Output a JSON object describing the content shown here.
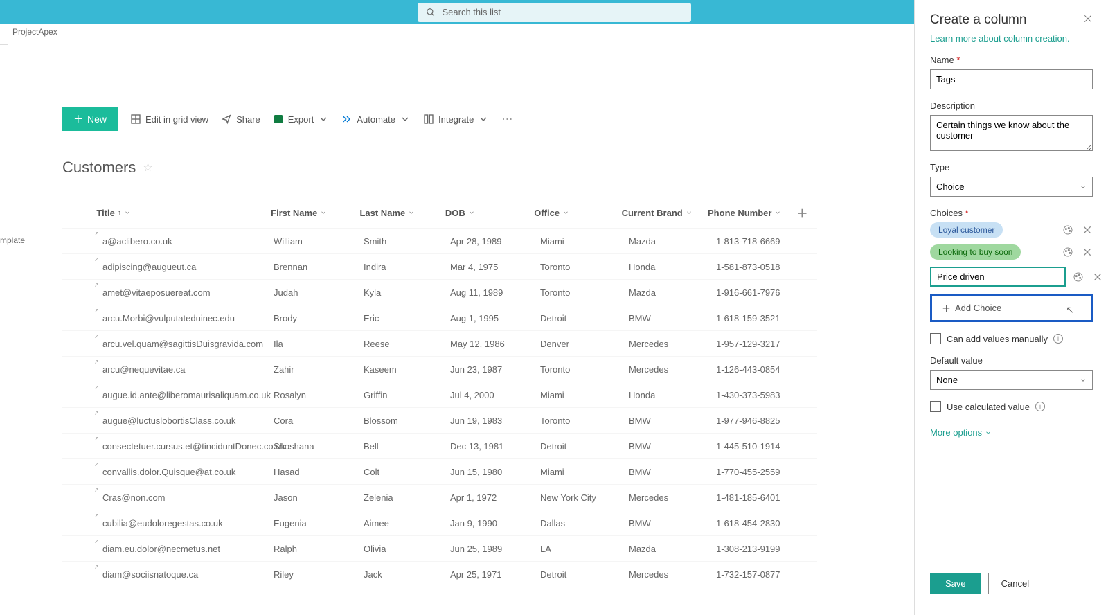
{
  "search": {
    "placeholder": "Search this list"
  },
  "breadcrumb": "ProjectApex",
  "leftnav": {
    "template": "mplate"
  },
  "cmdbar": {
    "new": "New",
    "edit_grid": "Edit in grid view",
    "share": "Share",
    "export": "Export",
    "automate": "Automate",
    "integrate": "Integrate"
  },
  "list": {
    "title": "Customers"
  },
  "columns": {
    "title": "Title",
    "first_name": "First Name",
    "last_name": "Last Name",
    "dob": "DOB",
    "office": "Office",
    "brand": "Current Brand",
    "phone": "Phone Number"
  },
  "rows": [
    {
      "title": "a@aclibero.co.uk",
      "fn": "William",
      "ln": "Smith",
      "dob": "Apr 28, 1989",
      "office": "Miami",
      "brand": "Mazda",
      "phone": "1-813-718-6669"
    },
    {
      "title": "adipiscing@augueut.ca",
      "fn": "Brennan",
      "ln": "Indira",
      "dob": "Mar 4, 1975",
      "office": "Toronto",
      "brand": "Honda",
      "phone": "1-581-873-0518"
    },
    {
      "title": "amet@vitaeposuereat.com",
      "fn": "Judah",
      "ln": "Kyla",
      "dob": "Aug 11, 1989",
      "office": "Toronto",
      "brand": "Mazda",
      "phone": "1-916-661-7976"
    },
    {
      "title": "arcu.Morbi@vulputateduinec.edu",
      "fn": "Brody",
      "ln": "Eric",
      "dob": "Aug 1, 1995",
      "office": "Detroit",
      "brand": "BMW",
      "phone": "1-618-159-3521"
    },
    {
      "title": "arcu.vel.quam@sagittisDuisgravida.com",
      "fn": "Ila",
      "ln": "Reese",
      "dob": "May 12, 1986",
      "office": "Denver",
      "brand": "Mercedes",
      "phone": "1-957-129-3217"
    },
    {
      "title": "arcu@nequevitae.ca",
      "fn": "Zahir",
      "ln": "Kaseem",
      "dob": "Jun 23, 1987",
      "office": "Toronto",
      "brand": "Mercedes",
      "phone": "1-126-443-0854"
    },
    {
      "title": "augue.id.ante@liberomaurisaliquam.co.uk",
      "fn": "Rosalyn",
      "ln": "Griffin",
      "dob": "Jul 4, 2000",
      "office": "Miami",
      "brand": "Honda",
      "phone": "1-430-373-5983"
    },
    {
      "title": "augue@luctuslobortisClass.co.uk",
      "fn": "Cora",
      "ln": "Blossom",
      "dob": "Jun 19, 1983",
      "office": "Toronto",
      "brand": "BMW",
      "phone": "1-977-946-8825"
    },
    {
      "title": "consectetuer.cursus.et@tinciduntDonec.co.uk",
      "fn": "Shoshana",
      "ln": "Bell",
      "dob": "Dec 13, 1981",
      "office": "Detroit",
      "brand": "BMW",
      "phone": "1-445-510-1914"
    },
    {
      "title": "convallis.dolor.Quisque@at.co.uk",
      "fn": "Hasad",
      "ln": "Colt",
      "dob": "Jun 15, 1980",
      "office": "Miami",
      "brand": "BMW",
      "phone": "1-770-455-2559"
    },
    {
      "title": "Cras@non.com",
      "fn": "Jason",
      "ln": "Zelenia",
      "dob": "Apr 1, 1972",
      "office": "New York City",
      "brand": "Mercedes",
      "phone": "1-481-185-6401"
    },
    {
      "title": "cubilia@eudoloregestas.co.uk",
      "fn": "Eugenia",
      "ln": "Aimee",
      "dob": "Jan 9, 1990",
      "office": "Dallas",
      "brand": "BMW",
      "phone": "1-618-454-2830"
    },
    {
      "title": "diam.eu.dolor@necmetus.net",
      "fn": "Ralph",
      "ln": "Olivia",
      "dob": "Jun 25, 1989",
      "office": "LA",
      "brand": "Mazda",
      "phone": "1-308-213-9199"
    },
    {
      "title": "diam@sociisnatoque.ca",
      "fn": "Riley",
      "ln": "Jack",
      "dob": "Apr 25, 1971",
      "office": "Detroit",
      "brand": "Mercedes",
      "phone": "1-732-157-0877"
    }
  ],
  "panel": {
    "title": "Create a column",
    "learn_more": "Learn more about column creation.",
    "name_label": "Name",
    "name_value": "Tags",
    "desc_label": "Description",
    "desc_value": "Certain things we know about the customer",
    "type_label": "Type",
    "type_value": "Choice",
    "choices_label": "Choices",
    "choices": [
      {
        "label": "Loyal customer",
        "bg": "#c7e0f4",
        "fg": "#2b579a"
      },
      {
        "label": "Looking to buy soon",
        "bg": "#9fd89f",
        "fg": "#0b6a0b"
      }
    ],
    "choice_input": "Price driven",
    "add_choice": "Add Choice",
    "can_add_manual": "Can add values manually",
    "default_label": "Default value",
    "default_value": "None",
    "use_calc": "Use calculated value",
    "more_options": "More options",
    "save": "Save",
    "cancel": "Cancel"
  }
}
